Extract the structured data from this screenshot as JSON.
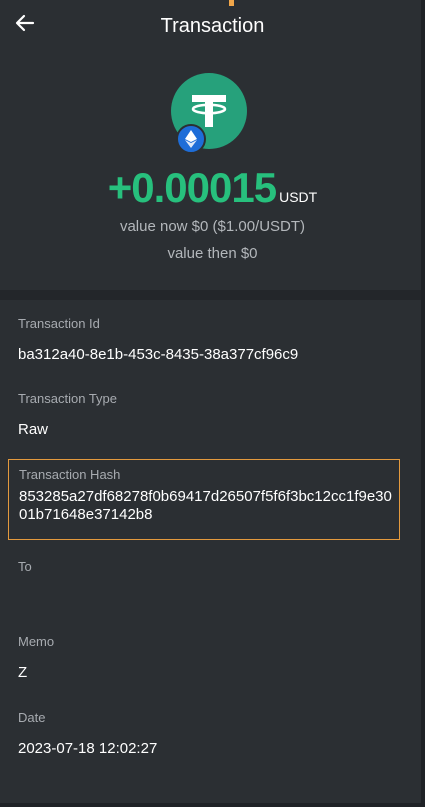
{
  "header": {
    "title": "Transaction",
    "back_icon": "arrow-left-icon"
  },
  "coin": {
    "icon": "tether-icon",
    "badge_icon": "ethereum-icon",
    "color": "#26a17b",
    "badge_color": "#1e6dd8"
  },
  "amount": {
    "value": "+0.00015",
    "unit": "USDT",
    "color": "#27c07d"
  },
  "value_now": "value now $0 ($1.00/USDT)",
  "value_then": "value then $0",
  "fields": {
    "transaction_id": {
      "label": "Transaction Id",
      "value": "ba312a40-8e1b-453c-8435-38a377cf96c9"
    },
    "transaction_type": {
      "label": "Transaction Type",
      "value": "Raw"
    },
    "transaction_hash": {
      "label": "Transaction Hash",
      "value": "853285a27df68278f0b69417d26507f5f6f3bc12cc1f9e3001b71648e37142b8",
      "highlight_color": "#e39a3e"
    },
    "to": {
      "label": "To",
      "value": ""
    },
    "memo": {
      "label": "Memo",
      "value": "Z"
    },
    "date": {
      "label": "Date",
      "value": "2023-07-18 12:02:27"
    }
  }
}
